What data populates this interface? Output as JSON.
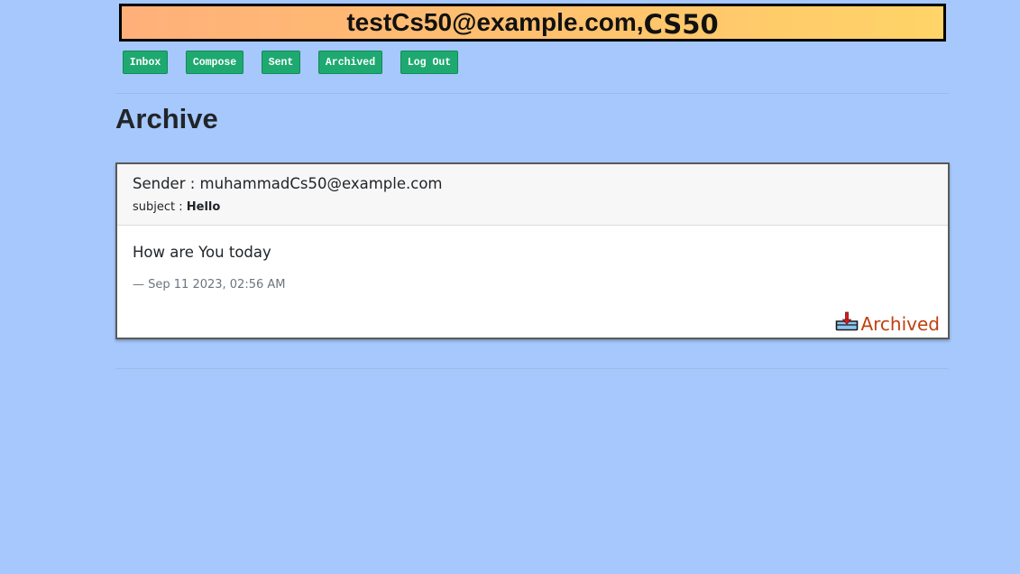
{
  "header": {
    "user_email": "testCs50@example.com",
    "separator": ",",
    "app_name": "CS50"
  },
  "nav": {
    "items": [
      {
        "label": "Inbox"
      },
      {
        "label": "Compose"
      },
      {
        "label": "Sent"
      },
      {
        "label": "Archived"
      },
      {
        "label": "Log Out"
      }
    ]
  },
  "main": {
    "title": "Archive",
    "emails": [
      {
        "sender_label": "Sender : ",
        "sender": "muhammadCs50@example.com",
        "subject_label": "subject : ",
        "subject": "Hello",
        "body": "How are You today",
        "timestamp": "— Sep 11 2023, 02:56 AM",
        "action_icon": "archive-tray-icon",
        "action_label": "Archived"
      }
    ]
  },
  "colors": {
    "background": "#a6c8fc",
    "nav_button": "#1ea970",
    "archived_label": "#c0410f"
  }
}
